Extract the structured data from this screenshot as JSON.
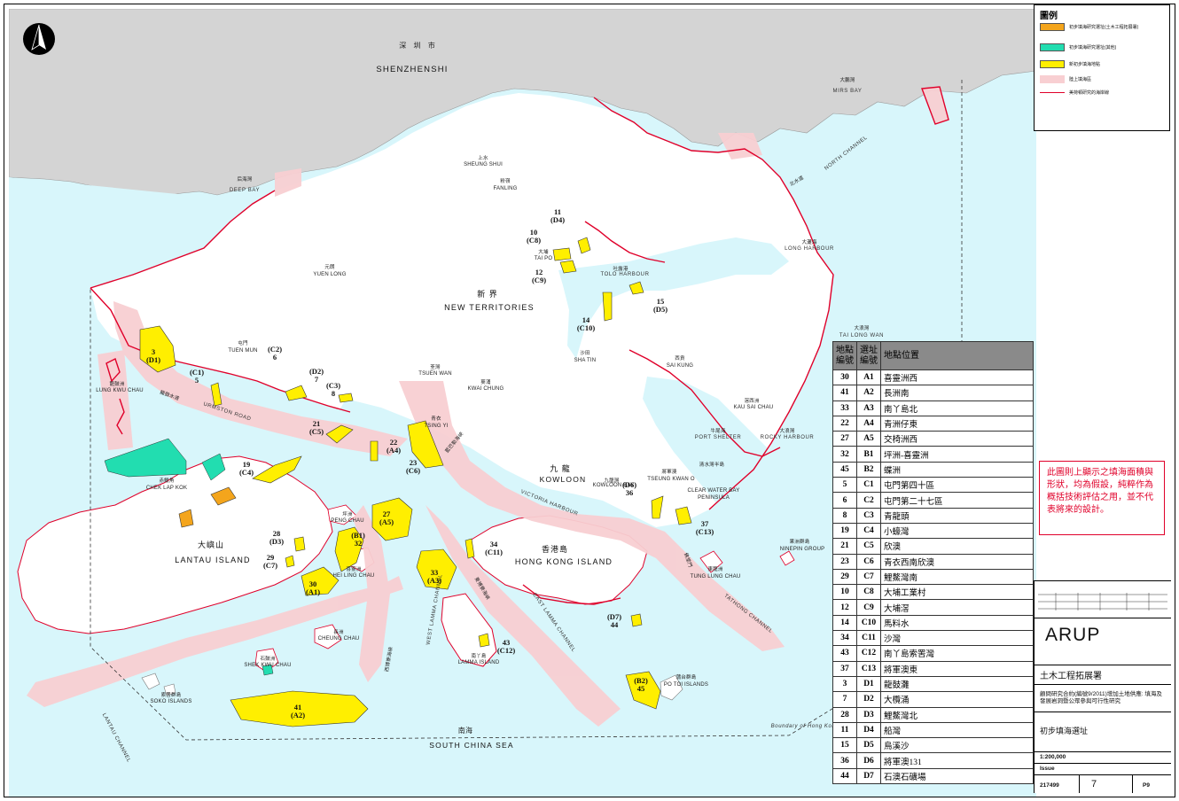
{
  "map": {
    "labels": {
      "shenzhen_cn": "深 圳 市",
      "shenzhen_en": "SHENZHENSHI",
      "mirs_bay_cn": "大鵬灣",
      "mirs_bay_en": "MIRS BAY",
      "deep_bay_cn": "后海灣",
      "deep_bay_en": "DEEP BAY",
      "north_channel_cn": "北水道",
      "north_channel_en": "NORTH CHANNEL",
      "sheung_shui_cn": "上水",
      "sheung_shui_en": "SHEUNG SHUI",
      "fanling_cn": "粉嶺",
      "fanling_en": "FANLING",
      "yuen_long_cn": "元朗",
      "yuen_long_en": "YUEN LONG",
      "new_territories_cn": "新 界",
      "new_territories_en": "NEW TERRITORIES",
      "tai_po_cn": "大埔",
      "tai_po_en": "TAI PO",
      "tolo_harbour_cn": "吐露港",
      "tolo_harbour_en": "TOLO HARBOUR",
      "long_harbour_cn": "大灘海",
      "long_harbour_en": "LONG HARBOUR",
      "tai_long_wan_cn": "大浪灣",
      "tai_long_wan_en": "TAI LONG WAN",
      "sha_tin_cn": "沙田",
      "sha_tin_en": "SHA TIN",
      "sai_kung_cn": "西貢",
      "sai_kung_en": "SAI KUNG",
      "tuen_mun_cn": "屯門",
      "tuen_mun_en": "TUEN MUN",
      "tsuen_wan_cn": "荃灣",
      "tsuen_wan_en": "TSUEN WAN",
      "kwai_chung_cn": "葵涌",
      "kwai_chung_en": "KWAI CHUNG",
      "lung_kwu_chau_cn": "龍鼓洲",
      "lung_kwu_chau_en": "LUNG KWU CHAU",
      "urmston_road_cn": "龍鼓水道",
      "urmston_road_en": "URMSTON ROAD",
      "tsing_yi_cn": "青衣",
      "tsing_yi_en": "TSING YI",
      "kowloon_cn": "九 龍",
      "kowloon_en": "KOWLOON",
      "kowloon_bay_cn": "九龍灣",
      "kowloon_bay_en": "KOWLOON BAY",
      "rambler_channel_cn": "藍巴勒海峽",
      "victoria_harbour_en": "VICTORIA HARBOUR",
      "chek_lap_kok_cn": "赤鱲角",
      "chek_lap_kok_en": "CHEK LAP KOK",
      "kau_sai_chau_cn": "滘西洲",
      "kau_sai_chau_en": "KAU SAI CHAU",
      "port_shelter_cn": "牛尾海",
      "port_shelter_en": "PORT SHELTER",
      "rocky_harbour_cn": "大浪灣",
      "rocky_harbour_en": "ROCKY HARBOUR",
      "tseung_kwan_o_cn": "將軍澳",
      "tseung_kwan_o_en": "TSEUNG KWAN O",
      "clear_water_bay_cn": "清水灣半島",
      "clear_water_bay_en": "CLEAR WATER BAY PENINSULA",
      "ninepin_cn": "果洲群島",
      "ninepin_en": "NINEPIN GROUP",
      "peng_chau_cn": "坪洲",
      "peng_chau_en": "PENG CHAU",
      "lantau_cn": "大嶼山",
      "lantau_en": "LANTAU ISLAND",
      "hong_kong_island_cn": "香港島",
      "hong_kong_island_en": "HONG KONG ISLAND",
      "hei_ling_chau_cn": "喜靈洲",
      "hei_ling_chau_en": "HEI LING CHAU",
      "west_lamma_channel_cn": "西博寮海峽",
      "west_lamma_channel_en": "WEST LAMMA CHANNEL",
      "east_lamma_channel_cn": "東博寮海峽",
      "east_lamma_channel_en": "EAST LAMMA CHANNEL",
      "tathong_channel_cn": "佛堂門",
      "tathong_channel_en": "TATHONG CHANNEL",
      "tung_lung_chau_cn": "東龍洲",
      "tung_lung_chau_en": "TUNG LUNG CHAU",
      "cheung_chau_cn": "長洲",
      "cheung_chau_en": "CHEUNG CHAU",
      "lamma_island_cn": "南丫島",
      "lamma_island_en": "LAMMA ISLAND",
      "shek_kwu_chau_cn": "石鼓洲",
      "shek_kwu_chau_en": "SHEK KWU CHAU",
      "soko_islands_cn": "索罟群島",
      "soko_islands_en": "SOKO ISLANDS",
      "po_toi_islands_cn": "蒲台群島",
      "po_toi_islands_en": "PO TOI ISLANDS",
      "lantau_channel_en": "LANTAU CHANNEL",
      "south_china_sea_cn": "南海",
      "south_china_sea_en": "SOUTH CHINA SEA",
      "boundary_en": "Boundary of Hong Kong"
    },
    "site_markers": [
      {
        "num": "3",
        "code": "(D1)"
      },
      {
        "num": "(C2)",
        "code": "6"
      },
      {
        "num": "(C1)",
        "code": "5"
      },
      {
        "num": "(D2)",
        "code": "7"
      },
      {
        "num": "(C3)",
        "code": "8"
      },
      {
        "num": "21",
        "code": "(C5)"
      },
      {
        "num": "22",
        "code": "(A4)"
      },
      {
        "num": "23",
        "code": "(C6)"
      },
      {
        "num": "19",
        "code": "(C4)"
      },
      {
        "num": "27",
        "code": "(A5)"
      },
      {
        "num": "(B1)",
        "code": "32"
      },
      {
        "num": "28",
        "code": "(D3)"
      },
      {
        "num": "29",
        "code": "(C7)"
      },
      {
        "num": "30",
        "code": "(A1)"
      },
      {
        "num": "33",
        "code": "(A3)"
      },
      {
        "num": "34",
        "code": "(C11)"
      },
      {
        "num": "43",
        "code": "(C12)"
      },
      {
        "num": "41",
        "code": "(A2)"
      },
      {
        "num": "11",
        "code": "(D4)"
      },
      {
        "num": "10",
        "code": "(C8)"
      },
      {
        "num": "12",
        "code": "(C9)"
      },
      {
        "num": "14",
        "code": "(C10)"
      },
      {
        "num": "15",
        "code": "(D5)"
      },
      {
        "num": "(D6)",
        "code": "36"
      },
      {
        "num": "37",
        "code": "(C13)"
      },
      {
        "num": "(D7)",
        "code": "44"
      },
      {
        "num": "(B2)",
        "code": "45"
      }
    ],
    "colors": {
      "sea": "#d8f6fb",
      "land": "#ffffff",
      "mainland": "#d4d4d4",
      "pink": "#f8cfd2",
      "red_coast": "#e0002a",
      "yellow": "#ffef00",
      "orange": "#f4a51c",
      "teal": "#22ddb0"
    }
  },
  "legend": {
    "title": "圖例",
    "items": [
      {
        "label": "初步填海研究選址(土木工程拓展署)",
        "color": "#f4a51c"
      },
      {
        "label": "初步填海研究選址(其他)",
        "color": "#22ddb0"
      },
      {
        "label": "新初步填海地點",
        "color": "#ffef00"
      },
      {
        "label": "陸上填海區",
        "color": "#f8cfd2"
      },
      {
        "label": "美荷頓研究的海岸線",
        "color": "#e0002a"
      }
    ]
  },
  "sites_table": {
    "headers": [
      "地點\n編號",
      "選址\n編號",
      "地點位置"
    ],
    "rows": [
      [
        "30",
        "A1",
        "喜靈洲西"
      ],
      [
        "41",
        "A2",
        "長洲南"
      ],
      [
        "33",
        "A3",
        "南丫島北"
      ],
      [
        "22",
        "A4",
        "青洲仔東"
      ],
      [
        "27",
        "A5",
        "交椅洲西"
      ],
      [
        "32",
        "B1",
        "坪洲-喜靈洲"
      ],
      [
        "45",
        "B2",
        "蝶洲"
      ],
      [
        "5",
        "C1",
        "屯門第四十區"
      ],
      [
        "6",
        "C2",
        "屯門第二十七區"
      ],
      [
        "8",
        "C3",
        "青龍頭"
      ],
      [
        "19",
        "C4",
        "小蠔灣"
      ],
      [
        "21",
        "C5",
        "欣澳"
      ],
      [
        "23",
        "C6",
        "青衣西南欣澳"
      ],
      [
        "29",
        "C7",
        "鯉鰲灣南"
      ],
      [
        "10",
        "C8",
        "大埔工業村"
      ],
      [
        "12",
        "C9",
        "大埔滘"
      ],
      [
        "14",
        "C10",
        "馬料水"
      ],
      [
        "34",
        "C11",
        "沙灣"
      ],
      [
        "43",
        "C12",
        "南丫島索罟灣"
      ],
      [
        "37",
        "C13",
        "將軍澳東"
      ],
      [
        "3",
        "D1",
        "龍鼓灘"
      ],
      [
        "7",
        "D2",
        "大欖涌"
      ],
      [
        "28",
        "D3",
        "鯉鰲灣北"
      ],
      [
        "11",
        "D4",
        "船灣"
      ],
      [
        "15",
        "D5",
        "烏溪沙"
      ],
      [
        "36",
        "D6",
        "將軍澳131"
      ],
      [
        "44",
        "D7",
        "石澳石礦場"
      ]
    ]
  },
  "note": "此圖則上顯示之填海面積與形狀，均為假設，純粹作為概括技術評估之用，並不代表將來的設計。",
  "title_block": {
    "company": "ARUP",
    "client": "土木工程拓展署",
    "job_title": "顧問研究合約(編號9/2011)增加土地供應: 填海及發展岩洞暨公眾參與可行性研究",
    "drawing_title": "初步填海選址",
    "scale": "1:200,000",
    "issue_label": "Issue",
    "job_no": "217499",
    "drawing_no": "7",
    "issue": "P9"
  }
}
